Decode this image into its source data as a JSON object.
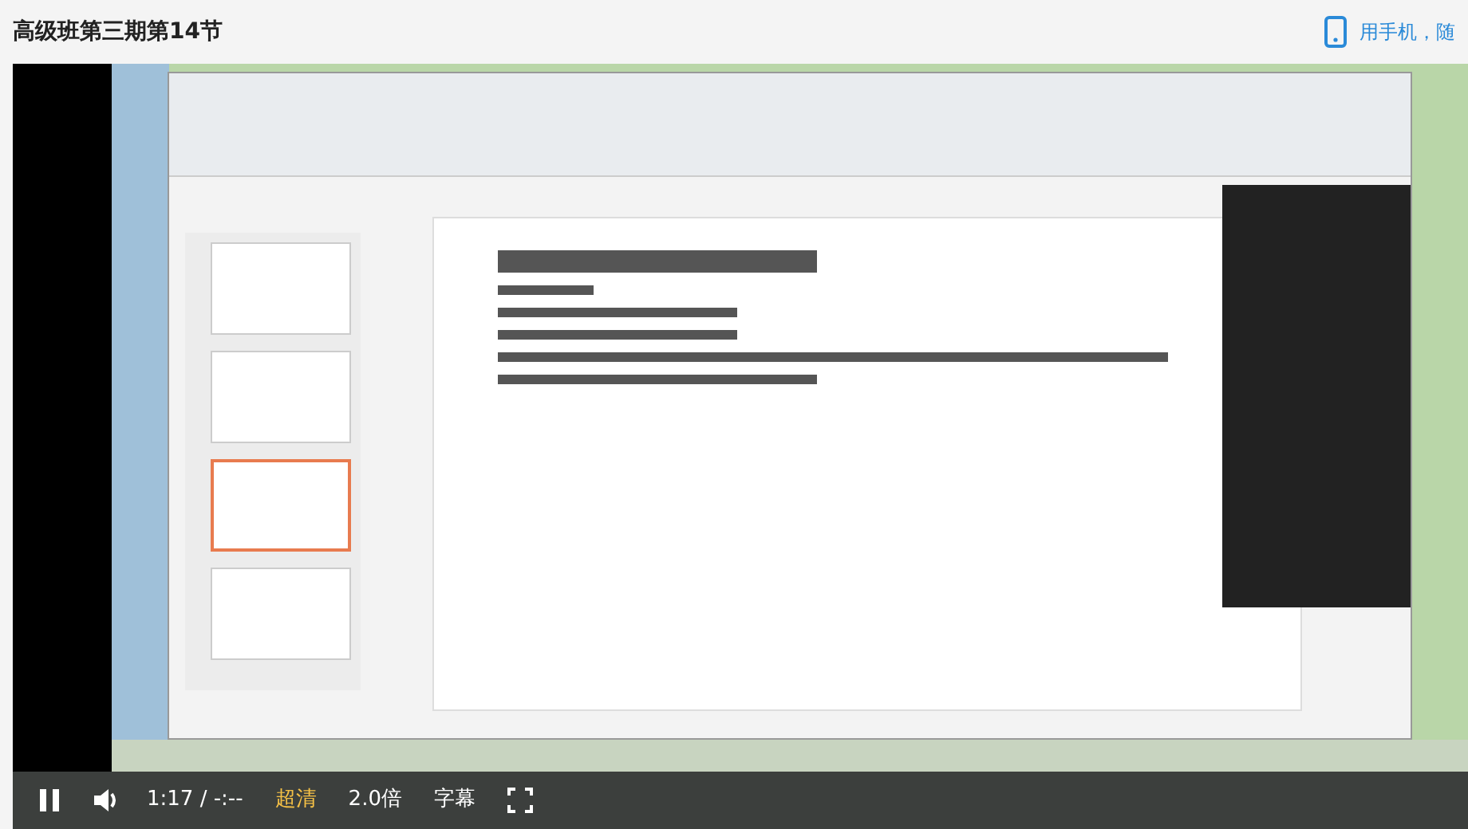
{
  "page": {
    "title": "高级班第三期第14节",
    "mobile_link": "用手机，随"
  },
  "player": {
    "playing": true,
    "time": "1:17 / -:--",
    "quality": "超清",
    "speed": "2.0倍",
    "subtitles": "字幕"
  }
}
